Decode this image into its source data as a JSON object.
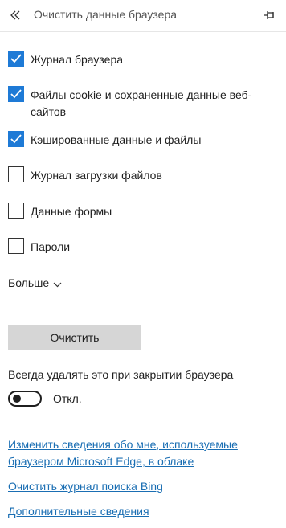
{
  "header": {
    "back_icon": "double-chevron-left-icon",
    "title": "Очистить данные браузера",
    "pin_icon": "pin-icon"
  },
  "options": [
    {
      "label": "Журнал браузера",
      "checked": true
    },
    {
      "label": "Файлы cookie и сохраненные данные веб-сайтов",
      "checked": true
    },
    {
      "label": "Кэшированные данные и файлы",
      "checked": true
    },
    {
      "label": "Журнал загрузки файлов",
      "checked": false
    },
    {
      "label": "Данные формы",
      "checked": false
    },
    {
      "label": "Пароли",
      "checked": false
    }
  ],
  "more": {
    "label": "Больше",
    "icon": "chevron-down-icon"
  },
  "clear_button": {
    "label": "Очистить"
  },
  "always_clear": {
    "label": "Всегда удалять это при закрытии браузера",
    "state_label": "Откл.",
    "enabled": false
  },
  "links": [
    {
      "label": "Изменить сведения обо мне, используемые браузером Microsoft Edge, в облаке"
    },
    {
      "label": "Очистить журнал поиска Bing"
    },
    {
      "label": "Дополнительные сведения"
    }
  ],
  "colors": {
    "accent": "#1e7ad6",
    "link": "#1a6eb3",
    "button_bg": "#d6d6d6"
  }
}
